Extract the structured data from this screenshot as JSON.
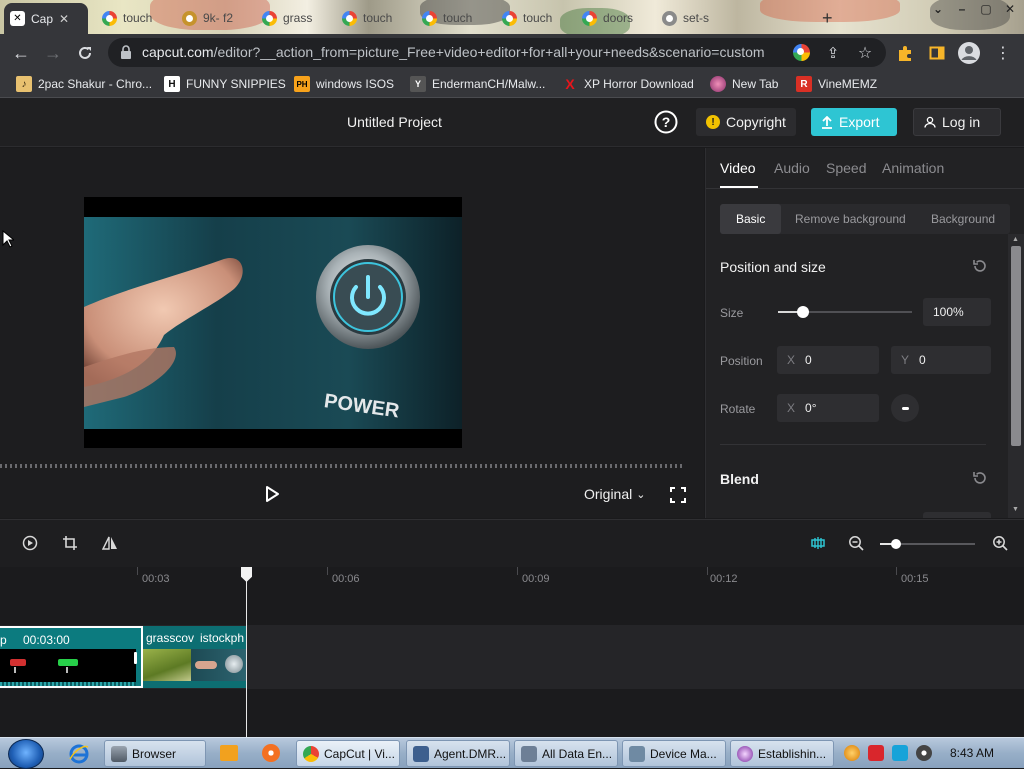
{
  "browser": {
    "tabs": [
      {
        "label": "Cap",
        "favicon": "capcut-icon",
        "active": true
      },
      {
        "label": "touch",
        "favicon": "google-icon"
      },
      {
        "label": "9k- f2",
        "favicon": "site-icon"
      },
      {
        "label": "grass",
        "favicon": "google-icon"
      },
      {
        "label": "touch",
        "favicon": "google-icon"
      },
      {
        "label": "touch",
        "favicon": "google-icon"
      },
      {
        "label": "touch",
        "favicon": "google-icon"
      },
      {
        "label": "doors",
        "favicon": "google-icon"
      },
      {
        "label": "set-s",
        "favicon": "site-icon"
      }
    ],
    "new_tab": "+",
    "url_domain": "capcut.com",
    "url_path": "/editor?__action_from=picture_Free+video+editor+for+all+your+needs&scenario=custom",
    "bookmarks": [
      {
        "label": "2pac Shakur - Chro...",
        "icon": "music-icon",
        "color": "#e8c170"
      },
      {
        "label": "FUNNY SNIPPIES",
        "icon": "H",
        "color": "#ffffff"
      },
      {
        "label": "windows ISOS",
        "icon": "PH",
        "color": "#f7a21b"
      },
      {
        "label": "EndermanCH/Malw...",
        "icon": "Y",
        "color": "#555555"
      },
      {
        "label": "XP Horror Download",
        "icon": "X",
        "color": "#e8151b"
      },
      {
        "label": "New Tab",
        "icon": "globe-icon",
        "color": "#c84a8a"
      },
      {
        "label": "VineMEMZ",
        "icon": "R",
        "color": "#d93025"
      }
    ]
  },
  "header": {
    "project_title": "Untitled Project",
    "copyright_label": "Copyright",
    "export_label": "Export",
    "login_label": "Log in",
    "accent": "#2ec5d3"
  },
  "preview": {
    "ratio_label": "Original",
    "video_text": "POWER"
  },
  "panel": {
    "tabs": [
      "Video",
      "Audio",
      "Speed",
      "Animation"
    ],
    "subtabs": [
      "Basic",
      "Remove background",
      "Background"
    ],
    "section_title": "Position and size",
    "size_label": "Size",
    "size_value": "100%",
    "size_fraction": 0.19,
    "position_label": "Position",
    "pos_x_axis": "X",
    "pos_x_value": "0",
    "pos_y_axis": "Y",
    "pos_y_value": "0",
    "rotate_label": "Rotate",
    "rotate_axis": "X",
    "rotate_value": "0°",
    "blend_title": "Blend"
  },
  "timeline": {
    "ruler": [
      "00:03",
      "00:06",
      "00:09",
      "00:12",
      "00:15"
    ],
    "zoom_fraction": 0.17,
    "clip_a": {
      "prefix": "p",
      "duration": "00:03:00"
    },
    "clip_b": {
      "label_1": "grasscov",
      "label_2": "istockph"
    }
  },
  "taskbar": {
    "items": [
      "Browser",
      "CapCut | Vi...",
      "Agent.DMR...",
      "All Data En...",
      "Device Ma...",
      "Establishin..."
    ],
    "clock": "8:43 AM"
  }
}
